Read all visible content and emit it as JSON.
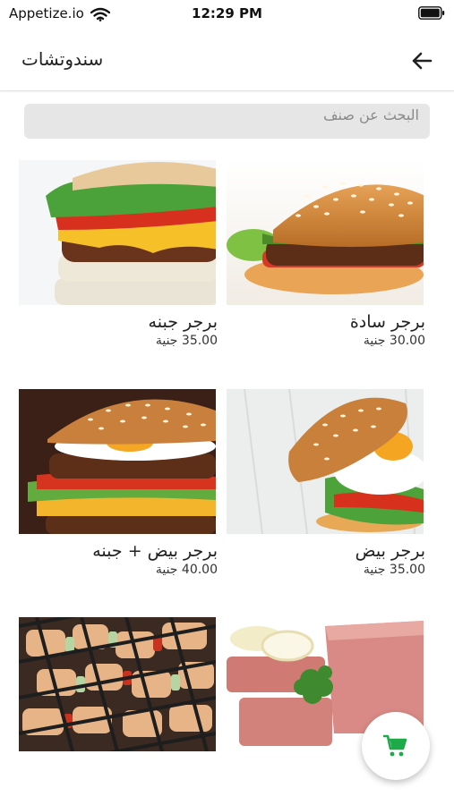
{
  "status_bar": {
    "carrier": "Appetize.io",
    "time": "12:29 PM"
  },
  "header": {
    "title": "سندوتشات",
    "back_icon": "arrow-left-icon"
  },
  "search": {
    "placeholder": "البحث عن صنف",
    "value": ""
  },
  "products": [
    {
      "name": "برجر سادة",
      "price": "30.00 جنية",
      "image": "plain-burger"
    },
    {
      "name": "برجر جبنه",
      "price": "35.00 جنية",
      "image": "cheese-burger"
    },
    {
      "name": "برجر بيض",
      "price": "35.00 جنية",
      "image": "egg-burger"
    },
    {
      "name": "برجر بيض + جبنه",
      "price": "40.00 جنية",
      "image": "egg-cheese-burger"
    },
    {
      "name": "",
      "price": "",
      "image": "luncheon-meat"
    },
    {
      "name": "",
      "price": "",
      "image": "grilled-kebab"
    }
  ],
  "cart": {
    "icon": "cart-icon",
    "accent_color": "#1faa4a"
  }
}
